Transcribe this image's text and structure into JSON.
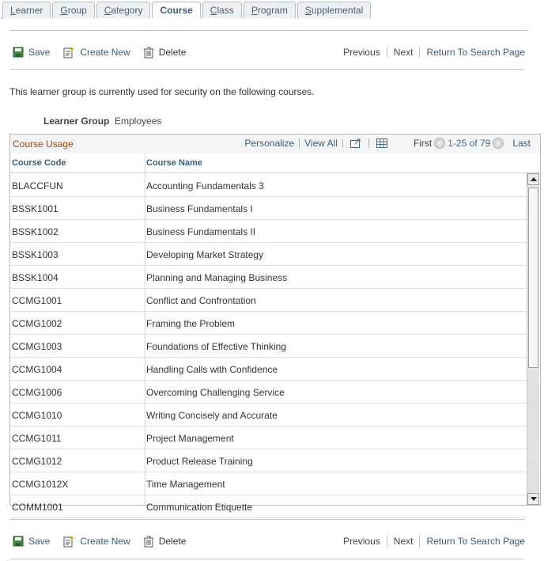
{
  "tabs": [
    {
      "label": "Learner",
      "u": "L",
      "rest": "earner"
    },
    {
      "label": "Group",
      "u": "G",
      "rest": "roup"
    },
    {
      "label": "Category",
      "u": "C",
      "rest": "ategory"
    },
    {
      "label": "Course",
      "u": "",
      "rest": "Course",
      "active": true
    },
    {
      "label": "Class",
      "u": "C",
      "rest": "lass"
    },
    {
      "label": "Program",
      "u": "P",
      "rest": "rogram"
    },
    {
      "label": "Supplemental",
      "u": "S",
      "rest": "upplemental"
    }
  ],
  "toolbar": {
    "save": "Save",
    "create_new": "Create New",
    "delete": "Delete",
    "previous": "Previous",
    "next": "Next",
    "return": "Return To Search Page"
  },
  "info_text": "This learner group is currently used for security on the following courses.",
  "learner_group": {
    "label": "Learner Group",
    "value": "Employees"
  },
  "grid": {
    "title": "Course Usage",
    "personalize": "Personalize",
    "view_all": "View All",
    "first": "First",
    "range": "1-25 of 79",
    "last": "Last",
    "col_code": "Course Code",
    "col_name": "Course Name",
    "rows": [
      {
        "code": "BLACCFUN",
        "name": "Accounting Fundamentals 3"
      },
      {
        "code": "BSSK1001",
        "name": "Business Fundamentals I"
      },
      {
        "code": "BSSK1002",
        "name": "Business Fundamentals II"
      },
      {
        "code": "BSSK1003",
        "name": "Developing Market Strategy"
      },
      {
        "code": "BSSK1004",
        "name": "Planning and Managing Business"
      },
      {
        "code": "CCMG1001",
        "name": "Conflict and Confrontation"
      },
      {
        "code": "CCMG1002",
        "name": "Framing the Problem"
      },
      {
        "code": "CCMG1003",
        "name": "Foundations of Effective Thinking"
      },
      {
        "code": "CCMG1004",
        "name": "Handling Calls with Confidence"
      },
      {
        "code": "CCMG1006",
        "name": "Overcoming Challenging Service"
      },
      {
        "code": "CCMG1010",
        "name": "Writing Concisely and Accurate"
      },
      {
        "code": "CCMG1011",
        "name": "Project Management"
      },
      {
        "code": "CCMG1012",
        "name": "Product Release Training"
      },
      {
        "code": "CCMG1012X",
        "name": "Time Management"
      },
      {
        "code": "COMM1001",
        "name": "Communication Etiquette"
      }
    ]
  }
}
